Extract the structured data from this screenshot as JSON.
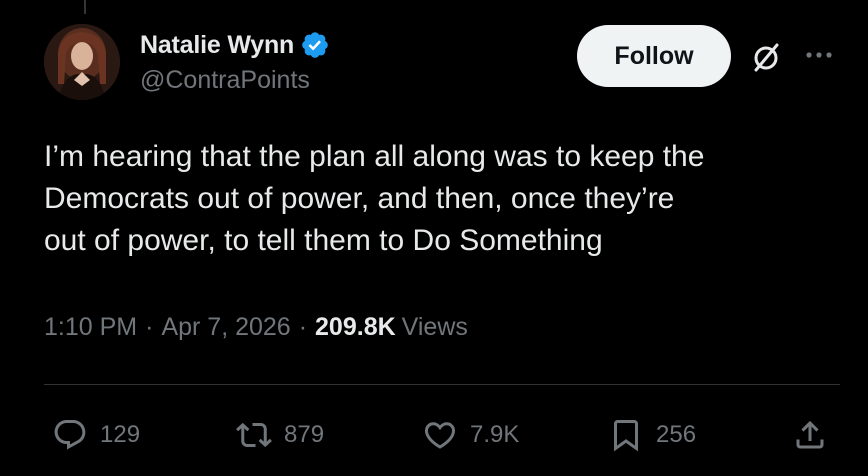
{
  "author": {
    "name": "Natalie Wynn",
    "handle": "@ContraPoints",
    "verified_color": "#1d9bf0"
  },
  "follow_button": {
    "label": "Follow"
  },
  "icons": {
    "verified": "verified-badge-icon",
    "grok": "grok-icon",
    "more": "more-options-icon",
    "reply": "reply-icon",
    "repost": "repost-icon",
    "like": "heart-icon",
    "bookmark": "bookmark-icon",
    "share": "share-icon"
  },
  "tweet": {
    "text": "I’m hearing that the plan all along was to keep the\nDemocrats out of power, and then, once they’re\nout of power, to tell them to Do Something"
  },
  "meta": {
    "time": "1:10 PM",
    "separator": "·",
    "date": "Apr 7, 2026",
    "views_count": "209.8K",
    "views_label": "Views"
  },
  "stats": {
    "replies": "129",
    "reposts": "879",
    "likes": "7.9K",
    "bookmarks": "256"
  },
  "colors": {
    "background": "#000000",
    "text_primary": "#e7e9ea",
    "text_secondary": "#71767b",
    "follow_bg": "#eff3f4",
    "accent": "#1d9bf0"
  }
}
